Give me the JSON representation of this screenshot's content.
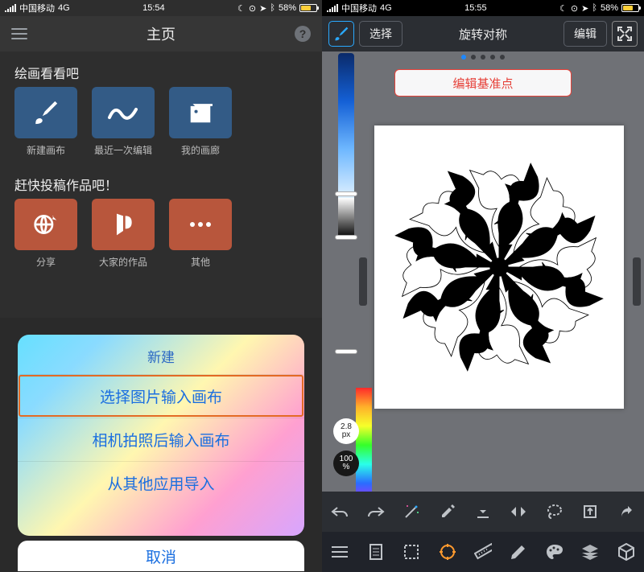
{
  "left": {
    "status": {
      "carrier": "中国移动",
      "network": "4G",
      "time": "15:54",
      "battery": "58%"
    },
    "title": "主页",
    "sections": {
      "draw": "绘画看看吧",
      "submit": "赶快投稿作品吧！"
    },
    "tiles": {
      "new_canvas": "新建画布",
      "last_edit": "最近一次编辑",
      "my_gallery": "我的画廊",
      "share": "分享",
      "everyone_works": "大家的作品",
      "other": "其他"
    },
    "sheet": {
      "title": "新建",
      "opt_image": "选择图片输入画布",
      "opt_camera": "相机拍照后输入画布",
      "opt_import": "从其他应用导入",
      "cancel": "取消"
    }
  },
  "right": {
    "status": {
      "carrier": "中国移动",
      "network": "4G",
      "time": "15:55",
      "battery": "58%"
    },
    "topbar": {
      "select": "选择",
      "title": "旋转对称",
      "edit": "编辑"
    },
    "pivot_button": "编辑基准点",
    "brush_size_value": "2.8",
    "brush_size_unit": "px",
    "opacity_value": "100",
    "opacity_unit": "%"
  }
}
